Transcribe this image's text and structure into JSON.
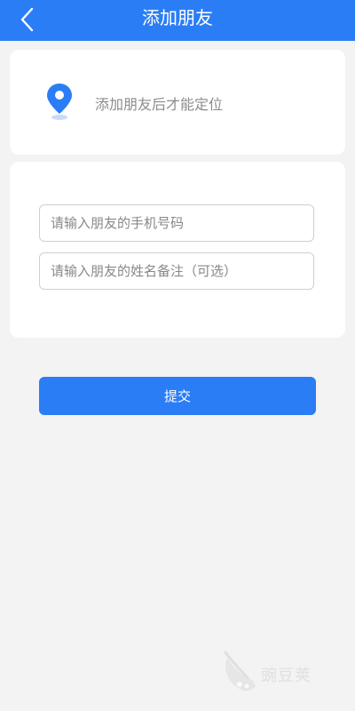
{
  "header": {
    "title": "添加朋友",
    "back_icon": "chevron-left-icon",
    "color": "#2b7df6"
  },
  "location_card": {
    "icon": "location-pin-icon",
    "text": "添加朋友后才能定位"
  },
  "form": {
    "phone_placeholder": "请输入朋友的手机号码",
    "name_placeholder": "请输入朋友的姓名备注（可选）"
  },
  "submit": {
    "label": "提交"
  },
  "watermark": {
    "text": "豌豆荚",
    "icon": "pea-pod-logo-icon"
  }
}
